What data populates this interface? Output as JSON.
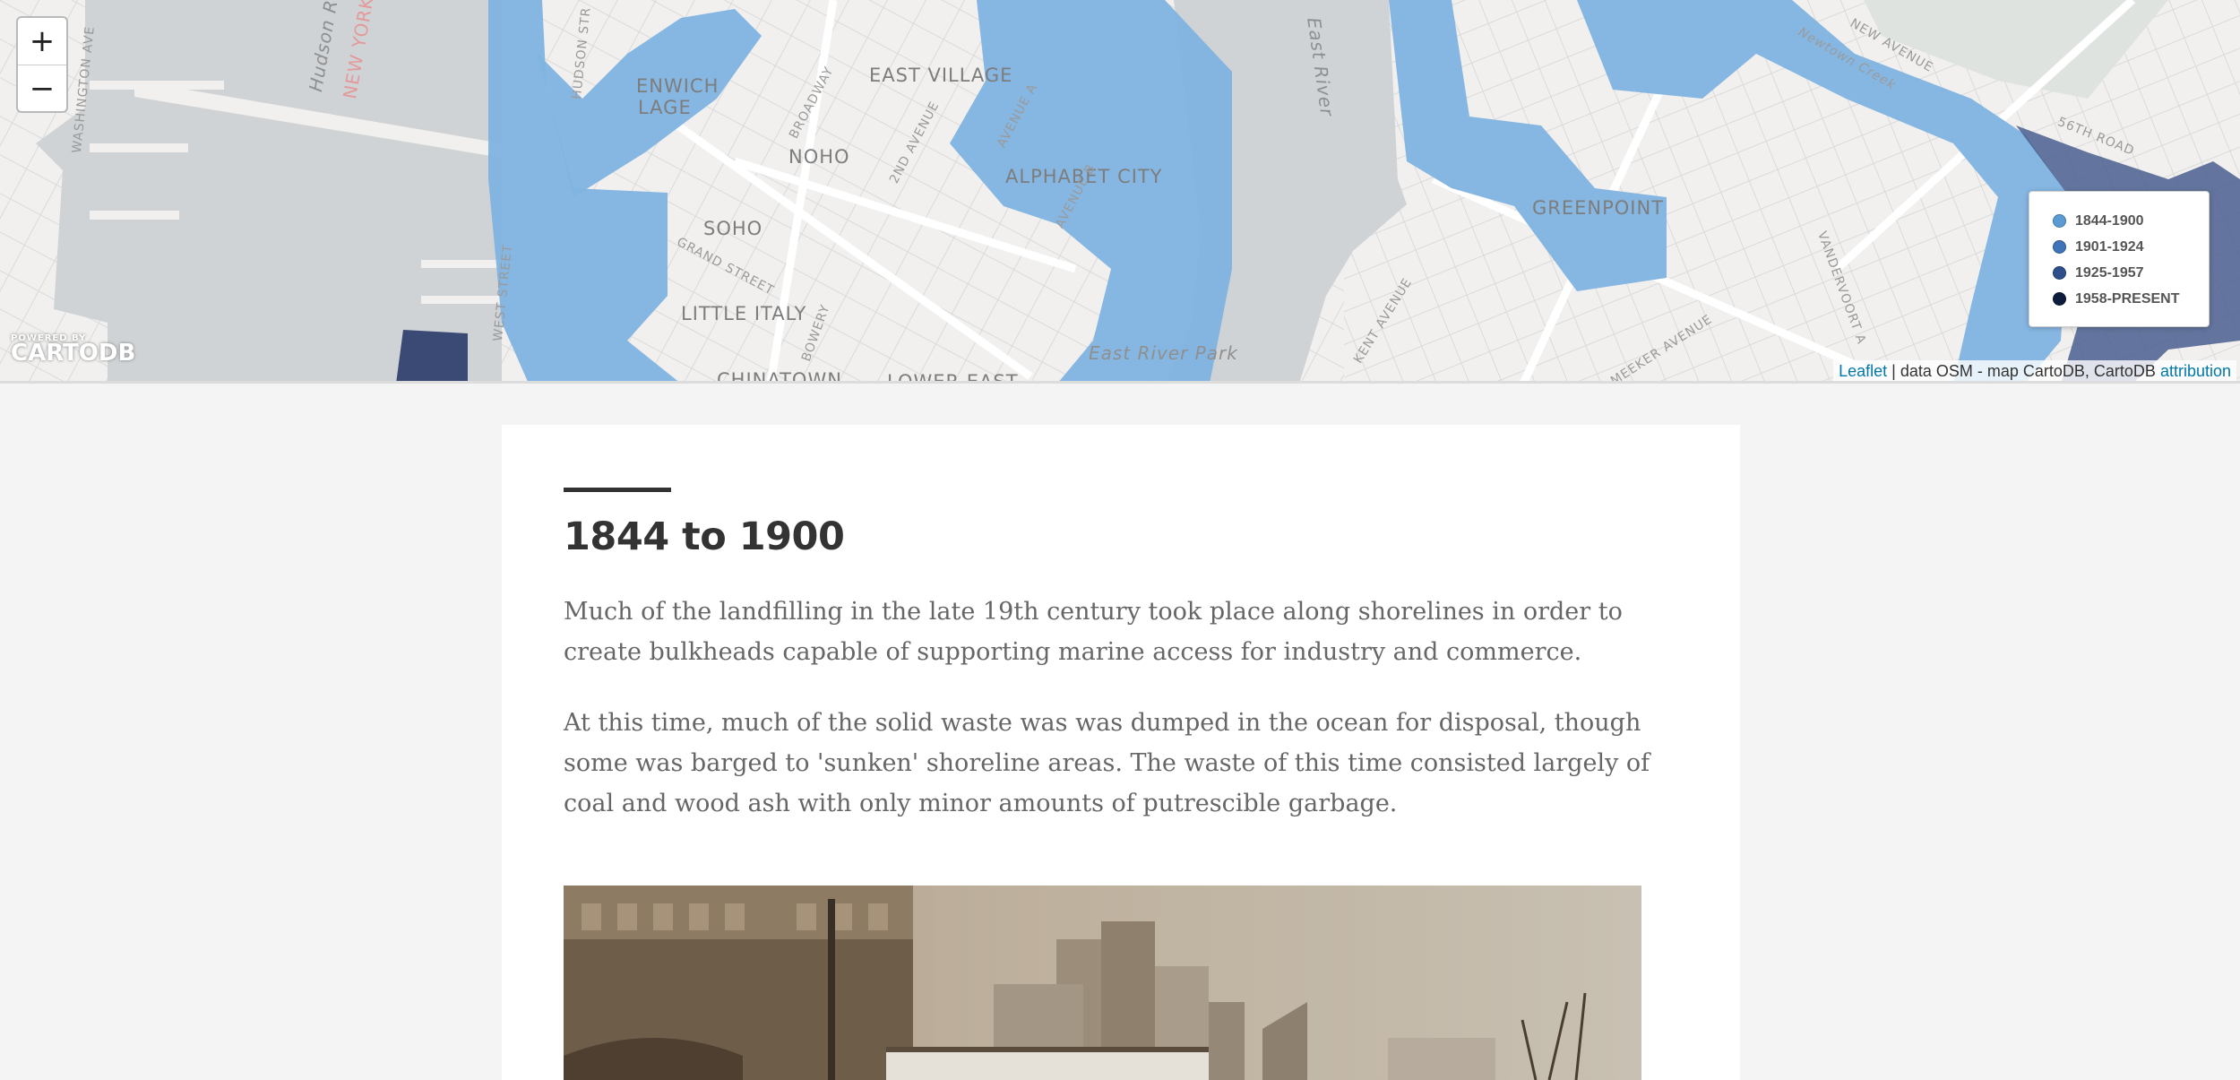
{
  "map": {
    "zoom_in": "+",
    "zoom_out": "−",
    "labels": {
      "east_village": "EAST VILLAGE",
      "greenwich_1": "ENWICH",
      "greenwich_2": "LAGE",
      "noho": "NOHO",
      "soho": "SOHO",
      "alphabet_city": "ALPHABET CITY",
      "little_italy": "LITTLE ITALY",
      "chinatown": "CHINATOWN",
      "lower_east": "LOWER EAST",
      "greenpoint": "GREENPOINT",
      "hudson_river": "Hudson Rive",
      "east_river": "East River",
      "east_river_park": "East River Park",
      "new_york": "NEW YORK",
      "broadway": "BROADWAY",
      "second_ave": "2ND AVENUE",
      "avenue_a": "AVENUE A",
      "avenue_b": "AVENUE B",
      "grand_street": "GRAND STREET",
      "bowery": "BOWERY",
      "west_street": "WEST STREET",
      "washington": "WASHINGTON AVE",
      "hudson_st": "HUDSON STR",
      "kent_ave": "KENT AVENUE",
      "meeker_ave": "MEEKER AVENUE",
      "vandervoort": "VANDERVOORT A",
      "sixth_road": "56TH ROAD",
      "new_avenue": "NEW AVENUE",
      "newtown_creek": "Newtown Creek"
    },
    "cartodb_small": "POWERED BY",
    "cartodb": "CARTODB",
    "legend": [
      {
        "label": "1844-1900",
        "color": "#5b9bd5"
      },
      {
        "label": "1901-1924",
        "color": "#3f74b8"
      },
      {
        "label": "1925-1957",
        "color": "#2c4f8c"
      },
      {
        "label": "1958-PRESENT",
        "color": "#0d1b3d"
      }
    ],
    "attribution": {
      "leaflet": "Leaflet",
      "text": " | data OSM - map CartoDB, CartoDB ",
      "link": "attribution"
    },
    "colors": {
      "fill_1844": "#7fb3e0",
      "fill_dark": "#4a5f8f",
      "water": "#cfd3d6",
      "land": "#f1f0ee"
    }
  },
  "article": {
    "title": "1844 to 1900",
    "paragraphs": [
      "Much of the landfilling in the late 19th century took place along shorelines in order to create bulkheads capable of supporting marine access for industry and commerce.",
      "At this time, much of the solid waste was was dumped in the ocean for disposal, though some was barged to 'sunken' shoreline areas. The waste of this time consisted largely of coal and wood ash with only minor amounts of putrescible garbage."
    ]
  }
}
